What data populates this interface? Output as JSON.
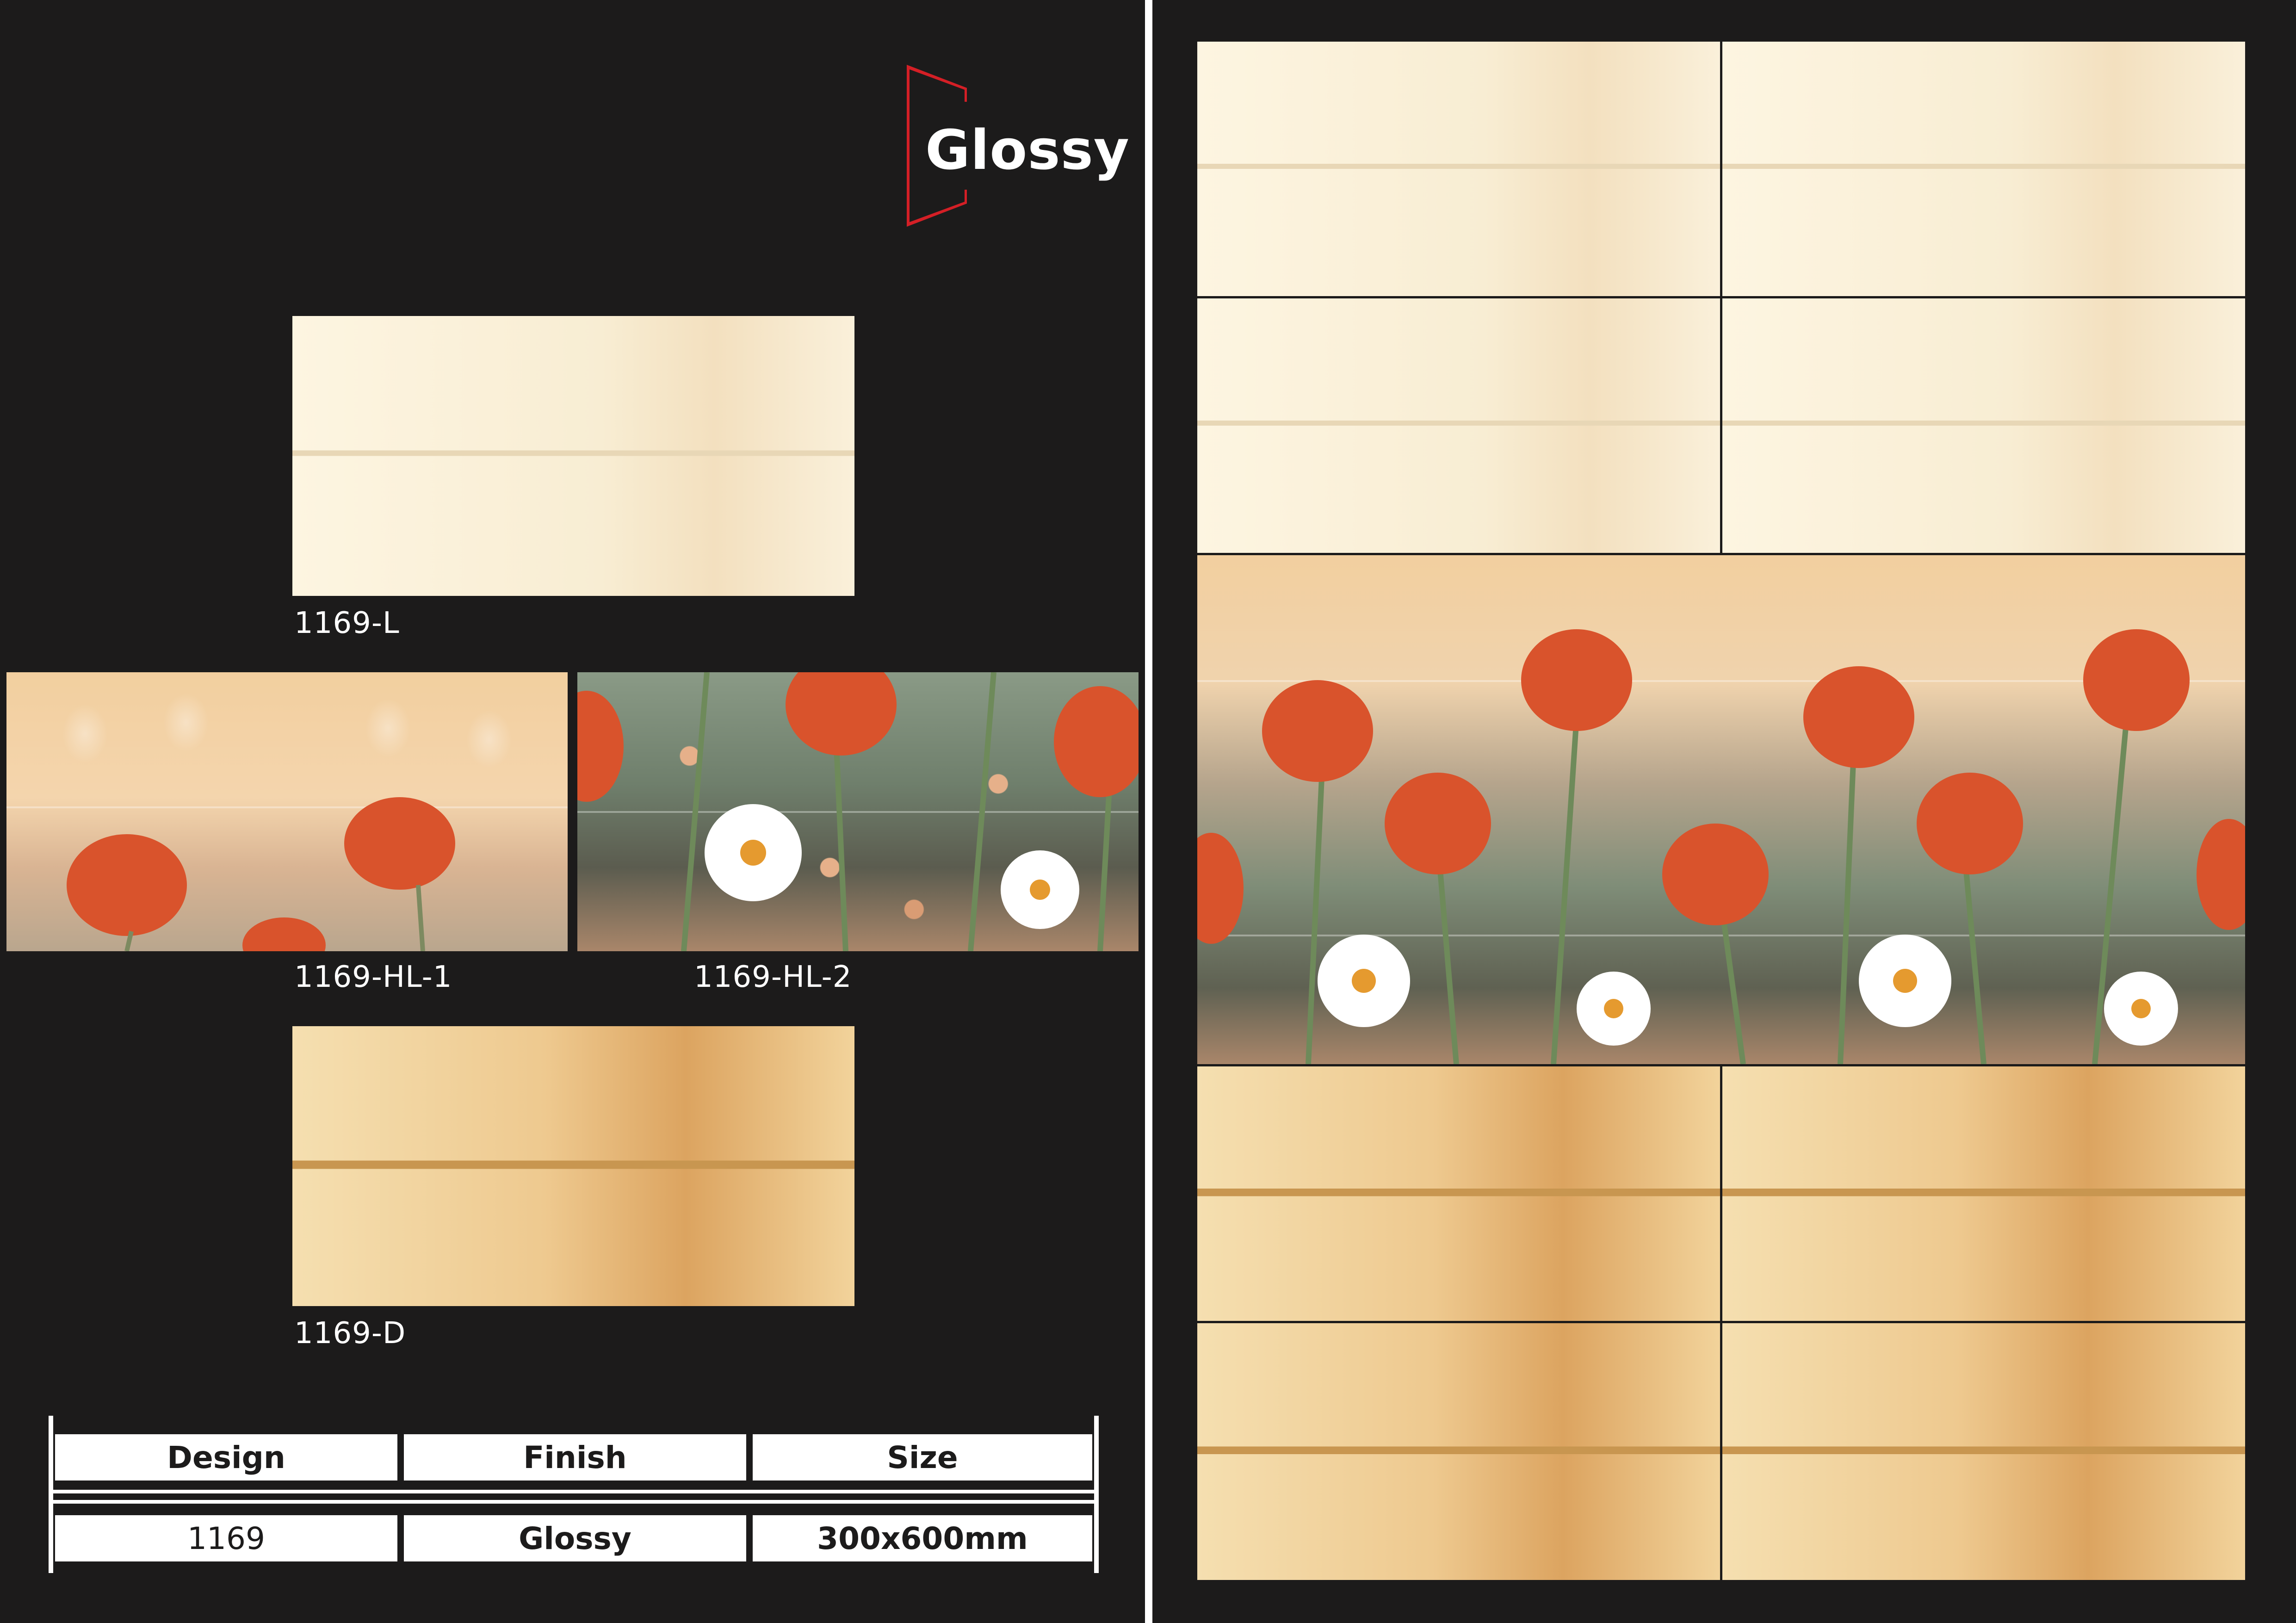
{
  "brand": {
    "logo_text": "Glossy",
    "accent": "#d41f26"
  },
  "tiles": [
    {
      "code": "1169-L"
    },
    {
      "code": "1169-HL-1"
    },
    {
      "code": "1169-HL-2"
    },
    {
      "code": "1169-D"
    }
  ],
  "spec_table": {
    "headers": [
      "Design",
      "Finish",
      "Size"
    ],
    "values": [
      "1169",
      "Glossy",
      "300x600mm"
    ]
  },
  "colors": {
    "background": "#1c1b1b",
    "light_tile": "#fbf1dc",
    "dark_tile": "#eec98f",
    "lotus": "#d9532c",
    "daisy": "#ffffff"
  }
}
